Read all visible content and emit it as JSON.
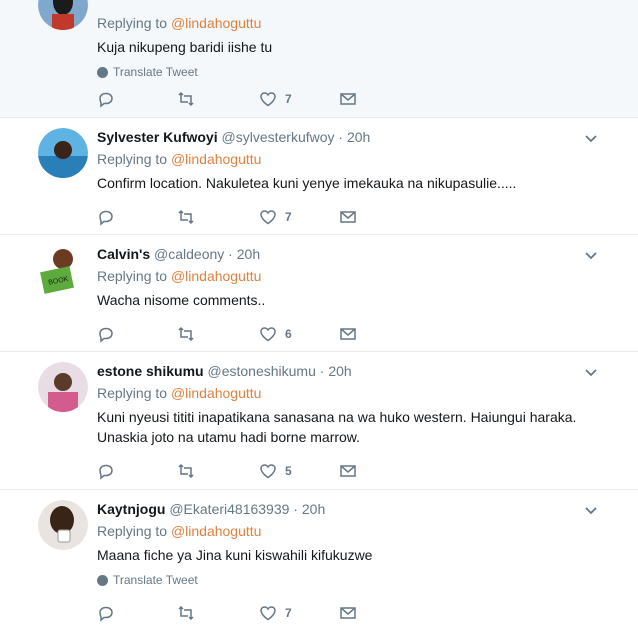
{
  "translate_label": "Translate Tweet",
  "replying_prefix": "Replying to",
  "tweets": [
    {
      "name": "",
      "handle": "",
      "time": "",
      "reply_to": "@lindahoguttu",
      "text": "Kuja nikupeng baridi iishe tu",
      "translate": true,
      "likes": "7",
      "highlight": true,
      "avatar_color": "#1b1b1b"
    },
    {
      "name": "Sylvester Kufwoyi",
      "handle": "@sylvesterkufwoy",
      "time": "20h",
      "reply_to": "@lindahoguttu",
      "text": "Confirm location. Nakuletea kuni yenye imekauka na nikupasulie.....",
      "translate": false,
      "likes": "7",
      "avatar_color": "#2a7fb8"
    },
    {
      "name": "Calvin's",
      "handle": "@caldeony",
      "time": "20h",
      "reply_to": "@lindahoguttu",
      "text": "Wacha nisome comments..",
      "translate": false,
      "likes": "6",
      "avatar_color": "#5cab3c"
    },
    {
      "name": "estone shikumu",
      "handle": "@estoneshikumu",
      "time": "20h",
      "reply_to": "@lindahoguttu",
      "text": "Kuni nyeusi tititi inapatikana sanasana na wa huko western. Haiungui haraka. Unaskia joto na utamu hadi borne marrow.",
      "translate": false,
      "likes": "5",
      "avatar_color": "#c9a6b4"
    },
    {
      "name": "Kaytnjogu",
      "handle": "@Ekateri48163939",
      "time": "20h",
      "reply_to": "@lindahoguttu",
      "text": "Maana fiche ya Jina kuni kiswahili kifukuzwe",
      "translate": true,
      "likes": "7",
      "avatar_color": "#3a2418"
    }
  ]
}
